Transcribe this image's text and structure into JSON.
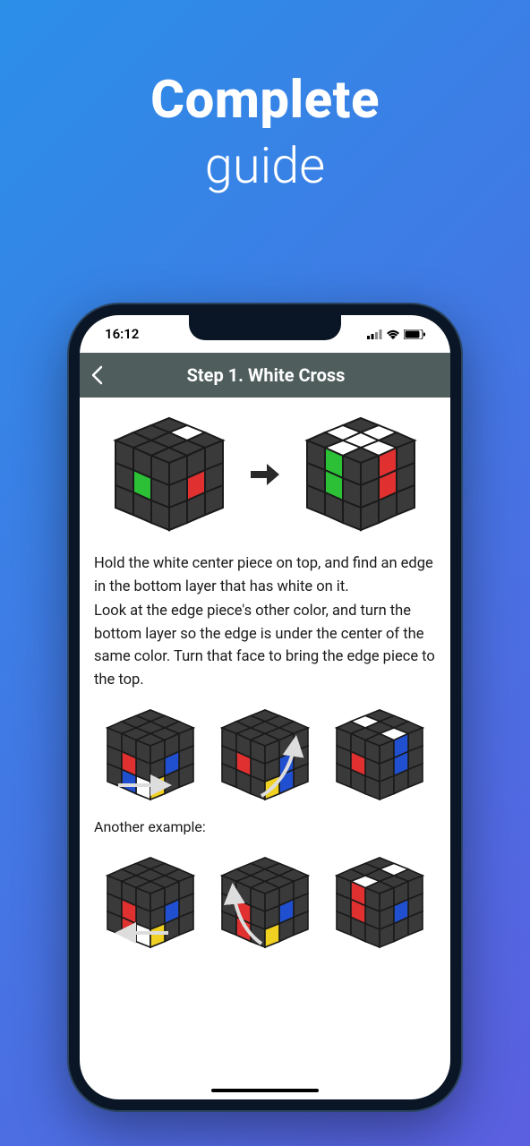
{
  "hero": {
    "bold": "Complete",
    "light": "guide"
  },
  "statusbar": {
    "time": "16:12"
  },
  "nav": {
    "title": "Step 1. White Cross"
  },
  "body": {
    "p1": "Hold the white center piece on top, and find an edge in the bottom layer that has white on it.",
    "p2": "Look at the edge piece's other color, and turn the bottom layer so the edge is under the center of the same color. Turn that face to bring the edge piece to the top.",
    "sub": "Another example:"
  },
  "colors": {
    "cube_body": "#3a3a3a",
    "cube_edge": "#1a1a1a",
    "white": "#ffffff",
    "green": "#2bc035",
    "red": "#e03030",
    "blue": "#2050d0",
    "yellow": "#f0d020"
  }
}
